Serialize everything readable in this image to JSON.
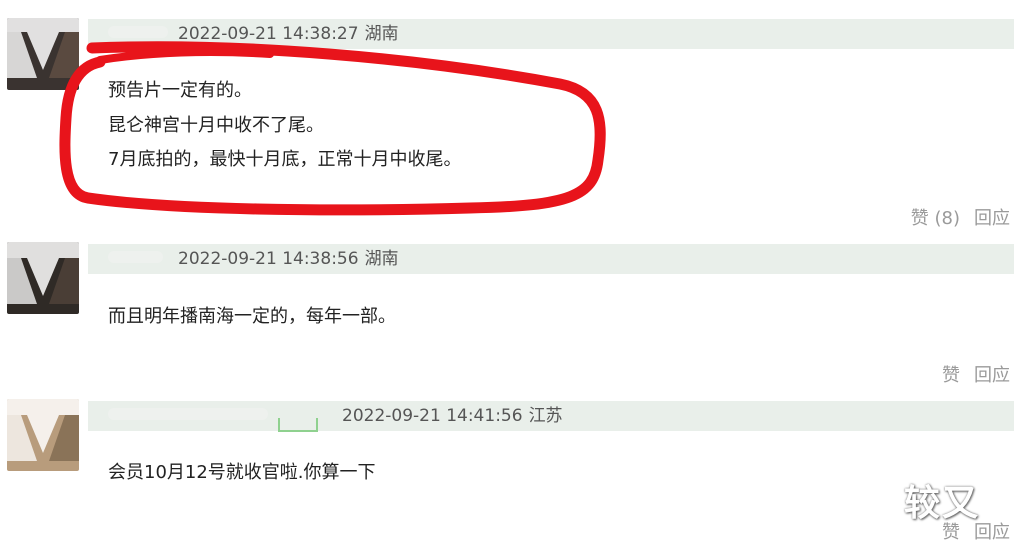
{
  "comments": [
    {
      "time": "2022-09-21 14:38:27",
      "location": "湖南",
      "lines": [
        "预告片一定有的。",
        "昆仑神宫十月中收不了尾。",
        "7月底拍的，最快十月底，正常十月中收尾。"
      ],
      "like_label": "赞",
      "like_count": "(8)",
      "reply_label": "回应"
    },
    {
      "time": "2022-09-21 14:38:56",
      "location": "湖南",
      "lines": [
        "而且明年播南海一定的，每年一部。"
      ],
      "like_label": "赞",
      "reply_label": "回应"
    },
    {
      "time": "2022-09-21 14:41:56",
      "location": "江苏",
      "lines": [
        "会员10月12号就收官啦.你算一下"
      ],
      "like_label": "赞",
      "reply_label": "回应"
    }
  ],
  "watermark": "较又",
  "colors": {
    "highlight": "#e8141b",
    "header_bg": "#e9efea",
    "action_text": "#9a9a9a"
  }
}
